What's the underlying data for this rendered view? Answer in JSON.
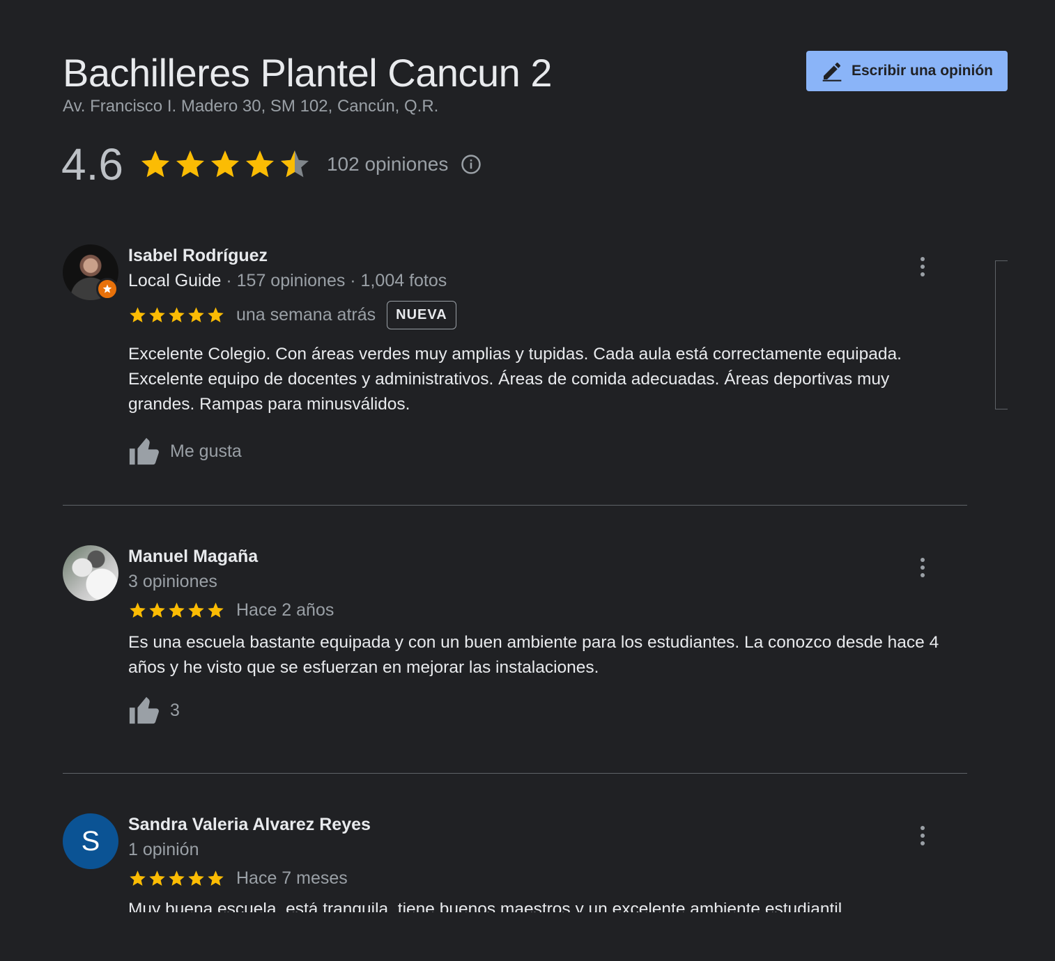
{
  "place": {
    "title": "Bachilleres Plantel Cancun 2",
    "address": "Av. Francisco I. Madero 30, SM 102, Cancún, Q.R.",
    "rating": "4.6",
    "rating_value": 4.6,
    "review_count": "102 opiniones"
  },
  "actions": {
    "write_review": "Escribir una opinión"
  },
  "colors": {
    "background": "#202124",
    "accent": "#8ab4f8",
    "star": "#fbbc04",
    "muted": "#9aa0a6",
    "guide_badge": "#e8710a",
    "avatar_letter_bg": "#0b5394"
  },
  "reviews": [
    {
      "name": "Isabel Rodríguez",
      "guide": "Local Guide",
      "stats": " · 157 opiniones · 1,004 fotos",
      "stars": 5,
      "when": "una semana atrás",
      "badge": "NUEVA",
      "text": "Excelente Colegio. Con áreas verdes muy amplias y tupidas. Cada aula está correctamente equipada. Excelente equipo de docentes y administrativos. Áreas de comida adecuadas. Áreas deportivas muy grandes. Rampas para minusválidos.",
      "like_label": "Me gusta"
    },
    {
      "name": "Manuel Magaña",
      "stats": "3 opiniones",
      "stars": 5,
      "when": "Hace 2 años",
      "text": "Es una escuela bastante equipada y con un buen ambiente para los estudiantes. La conozco desde hace 4 años y he visto que se esfuerzan en mejorar las instalaciones.",
      "like_label": "3"
    },
    {
      "name": "Sandra Valeria Alvarez Reyes",
      "avatar_letter": "S",
      "stats": "1 opinión",
      "stars": 5,
      "when": "Hace 7 meses",
      "text_clipped": "Muy buena escuela, está tranquila, tiene buenos maestros y un excelente ambiente estudiantil"
    }
  ],
  "icons": {
    "edit": "pencil-icon",
    "info": "info-icon",
    "like": "thumbs-up-icon",
    "menu": "more-vert-icon",
    "guide": "local-guide-badge-icon"
  }
}
